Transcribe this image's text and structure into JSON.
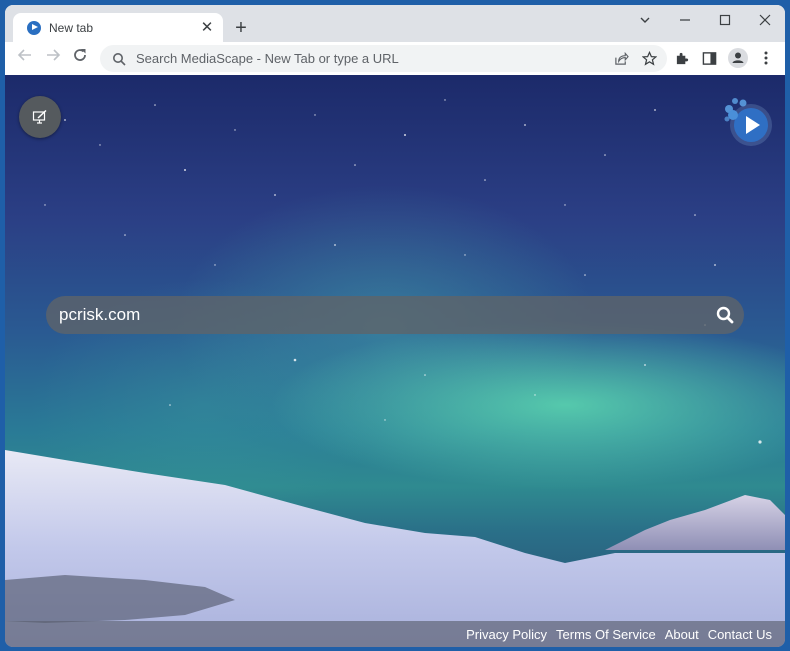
{
  "browser": {
    "tab": {
      "title": "New tab",
      "close_icon": "close-icon"
    },
    "new_tab_icon": "plus-icon",
    "window_controls": [
      "chevron-down-icon",
      "minimize-icon",
      "maximize-icon",
      "close-icon"
    ],
    "omnibox": {
      "placeholder": "Search MediaScape - New Tab or type a URL",
      "value": ""
    },
    "toolbar_icons": [
      "back-icon",
      "forward-icon",
      "reload-icon",
      "share-icon",
      "star-icon",
      "extensions-icon",
      "side-panel-icon",
      "profile-icon",
      "menu-icon"
    ]
  },
  "page": {
    "search": {
      "value": "pcrisk.com",
      "placeholder": ""
    },
    "customize_icon": "edit-background-icon",
    "logo_icon": "mediascape-play-icon",
    "footer_links": [
      "Privacy Policy",
      "Terms Of Service",
      "About",
      "Contact Us"
    ],
    "colors": {
      "brand": "#2a6fc1",
      "aurora": "#5fdcae",
      "sky": "#1c2a6a"
    }
  }
}
